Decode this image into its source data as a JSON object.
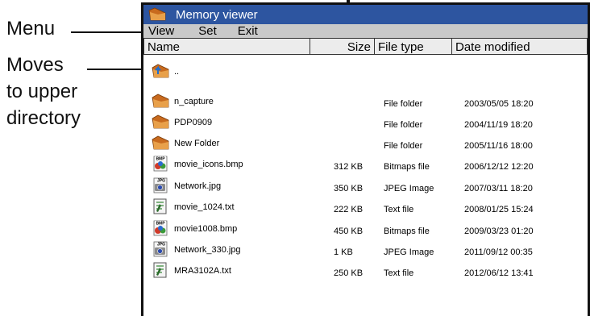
{
  "annotations": {
    "menu": "Menu",
    "moves_lines": [
      "Moves",
      "to upper",
      "directory"
    ]
  },
  "window": {
    "title": "Memory viewer",
    "app_icon": "folder-icon",
    "title_bar_color": "#2d55a0"
  },
  "menu": [
    "View",
    "Set",
    "Exit"
  ],
  "columns": [
    "Name",
    "Size",
    "File type",
    "Date modified"
  ],
  "files": [
    {
      "icon": "up-directory-icon",
      "name": "..",
      "size": "",
      "type": "",
      "date": ""
    },
    {
      "icon": "folder-icon",
      "name": "n_capture",
      "size": "",
      "type": "File folder",
      "date": "2003/05/05 18:20"
    },
    {
      "icon": "folder-icon",
      "name": "PDP0909",
      "size": "",
      "type": "File folder",
      "date": "2004/11/19 18:20"
    },
    {
      "icon": "folder-icon",
      "name": "New Folder",
      "size": "",
      "type": "File folder",
      "date": "2005/11/16 18:00"
    },
    {
      "icon": "bmp-file-icon",
      "name": "movie_icons.bmp",
      "size": "312 KB",
      "type": "Bitmaps file",
      "date": "2006/12/12 12:20"
    },
    {
      "icon": "jpg-file-icon",
      "name": "Network.jpg",
      "size": "350 KB",
      "type": "JPEG Image",
      "date": "2007/03/11 18:20"
    },
    {
      "icon": "txt-file-icon",
      "name": "movie_1024.txt",
      "size": "222 KB",
      "type": "Text file",
      "date": "2008/01/25 15:24"
    },
    {
      "icon": "bmp-file-icon",
      "name": "movie1008.bmp",
      "size": "450 KB",
      "type": "Bitmaps file",
      "date": "2009/03/23 01:20"
    },
    {
      "icon": "jpg-file-icon",
      "name": "Network_330.jpg",
      "size": "1 KB",
      "type": "JPEG Image",
      "date": "2011/09/12 00:35"
    },
    {
      "icon": "txt-file-icon",
      "name": "MRA3102A.txt",
      "size": "250 KB",
      "type": "Text file",
      "date": "2012/06/12 13:41"
    }
  ],
  "icon_labels": {
    "bmp": "BMP",
    "jpg": "JPG"
  }
}
